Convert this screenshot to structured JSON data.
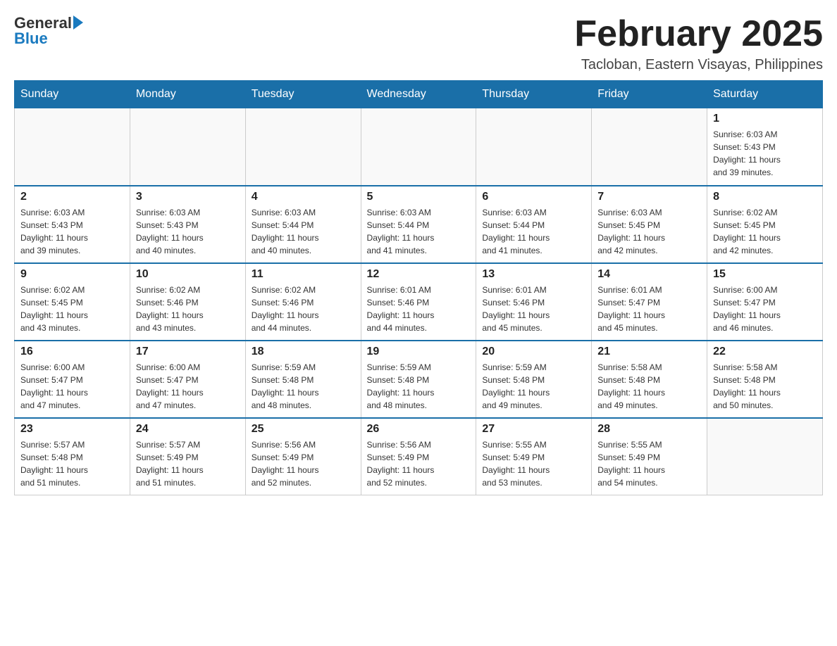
{
  "header": {
    "logo_general": "General",
    "logo_blue": "Blue",
    "title": "February 2025",
    "subtitle": "Tacloban, Eastern Visayas, Philippines"
  },
  "days_of_week": [
    "Sunday",
    "Monday",
    "Tuesday",
    "Wednesday",
    "Thursday",
    "Friday",
    "Saturday"
  ],
  "weeks": [
    [
      {
        "day": "",
        "info": ""
      },
      {
        "day": "",
        "info": ""
      },
      {
        "day": "",
        "info": ""
      },
      {
        "day": "",
        "info": ""
      },
      {
        "day": "",
        "info": ""
      },
      {
        "day": "",
        "info": ""
      },
      {
        "day": "1",
        "info": "Sunrise: 6:03 AM\nSunset: 5:43 PM\nDaylight: 11 hours\nand 39 minutes."
      }
    ],
    [
      {
        "day": "2",
        "info": "Sunrise: 6:03 AM\nSunset: 5:43 PM\nDaylight: 11 hours\nand 39 minutes."
      },
      {
        "day": "3",
        "info": "Sunrise: 6:03 AM\nSunset: 5:43 PM\nDaylight: 11 hours\nand 40 minutes."
      },
      {
        "day": "4",
        "info": "Sunrise: 6:03 AM\nSunset: 5:44 PM\nDaylight: 11 hours\nand 40 minutes."
      },
      {
        "day": "5",
        "info": "Sunrise: 6:03 AM\nSunset: 5:44 PM\nDaylight: 11 hours\nand 41 minutes."
      },
      {
        "day": "6",
        "info": "Sunrise: 6:03 AM\nSunset: 5:44 PM\nDaylight: 11 hours\nand 41 minutes."
      },
      {
        "day": "7",
        "info": "Sunrise: 6:03 AM\nSunset: 5:45 PM\nDaylight: 11 hours\nand 42 minutes."
      },
      {
        "day": "8",
        "info": "Sunrise: 6:02 AM\nSunset: 5:45 PM\nDaylight: 11 hours\nand 42 minutes."
      }
    ],
    [
      {
        "day": "9",
        "info": "Sunrise: 6:02 AM\nSunset: 5:45 PM\nDaylight: 11 hours\nand 43 minutes."
      },
      {
        "day": "10",
        "info": "Sunrise: 6:02 AM\nSunset: 5:46 PM\nDaylight: 11 hours\nand 43 minutes."
      },
      {
        "day": "11",
        "info": "Sunrise: 6:02 AM\nSunset: 5:46 PM\nDaylight: 11 hours\nand 44 minutes."
      },
      {
        "day": "12",
        "info": "Sunrise: 6:01 AM\nSunset: 5:46 PM\nDaylight: 11 hours\nand 44 minutes."
      },
      {
        "day": "13",
        "info": "Sunrise: 6:01 AM\nSunset: 5:46 PM\nDaylight: 11 hours\nand 45 minutes."
      },
      {
        "day": "14",
        "info": "Sunrise: 6:01 AM\nSunset: 5:47 PM\nDaylight: 11 hours\nand 45 minutes."
      },
      {
        "day": "15",
        "info": "Sunrise: 6:00 AM\nSunset: 5:47 PM\nDaylight: 11 hours\nand 46 minutes."
      }
    ],
    [
      {
        "day": "16",
        "info": "Sunrise: 6:00 AM\nSunset: 5:47 PM\nDaylight: 11 hours\nand 47 minutes."
      },
      {
        "day": "17",
        "info": "Sunrise: 6:00 AM\nSunset: 5:47 PM\nDaylight: 11 hours\nand 47 minutes."
      },
      {
        "day": "18",
        "info": "Sunrise: 5:59 AM\nSunset: 5:48 PM\nDaylight: 11 hours\nand 48 minutes."
      },
      {
        "day": "19",
        "info": "Sunrise: 5:59 AM\nSunset: 5:48 PM\nDaylight: 11 hours\nand 48 minutes."
      },
      {
        "day": "20",
        "info": "Sunrise: 5:59 AM\nSunset: 5:48 PM\nDaylight: 11 hours\nand 49 minutes."
      },
      {
        "day": "21",
        "info": "Sunrise: 5:58 AM\nSunset: 5:48 PM\nDaylight: 11 hours\nand 49 minutes."
      },
      {
        "day": "22",
        "info": "Sunrise: 5:58 AM\nSunset: 5:48 PM\nDaylight: 11 hours\nand 50 minutes."
      }
    ],
    [
      {
        "day": "23",
        "info": "Sunrise: 5:57 AM\nSunset: 5:48 PM\nDaylight: 11 hours\nand 51 minutes."
      },
      {
        "day": "24",
        "info": "Sunrise: 5:57 AM\nSunset: 5:49 PM\nDaylight: 11 hours\nand 51 minutes."
      },
      {
        "day": "25",
        "info": "Sunrise: 5:56 AM\nSunset: 5:49 PM\nDaylight: 11 hours\nand 52 minutes."
      },
      {
        "day": "26",
        "info": "Sunrise: 5:56 AM\nSunset: 5:49 PM\nDaylight: 11 hours\nand 52 minutes."
      },
      {
        "day": "27",
        "info": "Sunrise: 5:55 AM\nSunset: 5:49 PM\nDaylight: 11 hours\nand 53 minutes."
      },
      {
        "day": "28",
        "info": "Sunrise: 5:55 AM\nSunset: 5:49 PM\nDaylight: 11 hours\nand 54 minutes."
      },
      {
        "day": "",
        "info": ""
      }
    ]
  ]
}
